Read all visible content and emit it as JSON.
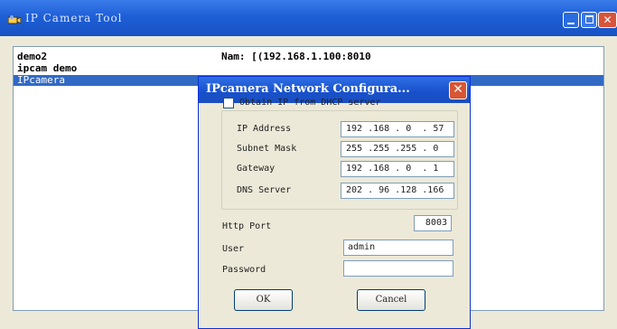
{
  "main_window": {
    "title": "IP Camera Tool",
    "cameras": [
      {
        "name": "demo2",
        "info": "Nam: [(192.168.1.100:8010"
      },
      {
        "name": "ipcam demo",
        "info": ""
      },
      {
        "name": "IPcamera",
        "info": "",
        "selected": true
      }
    ]
  },
  "dialog": {
    "title": "IPcamera Network Configura...",
    "dhcp_label": "Obtain IP from DHCP server",
    "dhcp_checked": false,
    "fields": {
      "ip_address": {
        "label": "IP Address",
        "value": "192 .168 . 0  . 57"
      },
      "subnet_mask": {
        "label": "Subnet Mask",
        "value": "255 .255 .255 . 0"
      },
      "gateway": {
        "label": "Gateway",
        "value": "192 .168 . 0  . 1"
      },
      "dns_server": {
        "label": "DNS Server",
        "value": "202 . 96 .128 .166"
      }
    },
    "http_port": {
      "label": "Http Port",
      "value": "8003"
    },
    "user": {
      "label": "User",
      "value": "admin"
    },
    "password": {
      "label": "Password",
      "value": ""
    },
    "ok_label": "OK",
    "cancel_label": "Cancel"
  },
  "colors": {
    "titlebar": "#1e5fd6",
    "selection": "#316ac5",
    "close": "#d95534"
  }
}
